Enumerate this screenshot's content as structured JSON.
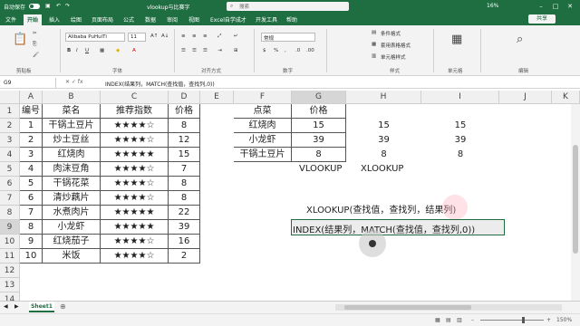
{
  "titlebar": {
    "autosave": "自动保存",
    "filename": "vlookup与比赛字",
    "search_placeholder": "搜索",
    "zoom_label": "16%"
  },
  "tabs": [
    "文件",
    "开始",
    "插入",
    "绘图",
    "页面布局",
    "公式",
    "数据",
    "审阅",
    "视图",
    "Excel自学成才",
    "开发工具",
    "帮助"
  ],
  "share_label": "共享",
  "ribbon": {
    "clipboard": "剪贴板",
    "font_name": "Alibaba PuHuiTi",
    "font_size": "11",
    "font_group": "字体",
    "align_group": "对齐方式",
    "number_group": "数字",
    "number_format": "常规",
    "styles": [
      "条件格式",
      "套用表格格式",
      "单元格样式"
    ],
    "styles_group": "样式",
    "cells_group": "单元格",
    "edit_group": "编辑"
  },
  "formula_bar": {
    "name_box": "G9",
    "formula": "INDEX(结果列，MATCH(查找值，查找列,0))"
  },
  "columns": [
    "A",
    "B",
    "C",
    "D",
    "E",
    "F",
    "G",
    "H",
    "I",
    "J",
    "K"
  ],
  "rows": [
    "1",
    "2",
    "3",
    "4",
    "5",
    "6",
    "7",
    "8",
    "9",
    "10",
    "11",
    "12",
    "13",
    "14",
    "15"
  ],
  "table1": {
    "headers": [
      "编号",
      "菜名",
      "推荐指数",
      "价格"
    ],
    "rows": [
      [
        "1",
        "干锅土豆片",
        "★★★★☆",
        "8"
      ],
      [
        "2",
        "炒土豆丝",
        "★★★★☆",
        "12"
      ],
      [
        "3",
        "红烧肉",
        "★★★★★",
        "15"
      ],
      [
        "4",
        "肉沫豆角",
        "★★★★☆",
        "7"
      ],
      [
        "5",
        "干锅花菜",
        "★★★★☆",
        "8"
      ],
      [
        "6",
        "清炒藕片",
        "★★★★☆",
        "8"
      ],
      [
        "7",
        "水煮肉片",
        "★★★★★",
        "22"
      ],
      [
        "8",
        "小龙虾",
        "★★★★★",
        "39"
      ],
      [
        "9",
        "红烧茄子",
        "★★★★☆",
        "16"
      ],
      [
        "10",
        "米饭",
        "★★★★☆",
        "2"
      ]
    ]
  },
  "table2": {
    "headers": [
      "点菜",
      "价格"
    ],
    "rows": [
      [
        "红烧肉",
        "15"
      ],
      [
        "小龙虾",
        "39"
      ],
      [
        "干锅土豆片",
        "8"
      ]
    ]
  },
  "col_h": [
    "15",
    "39",
    "8"
  ],
  "col_i": [
    "15",
    "39",
    "8"
  ],
  "labels": {
    "vlookup1": "VLOOKUP",
    "vlookup2": "XLOOKUP",
    "xlookup_formula": "XLOOKUP(查找值，查找列，结果列)",
    "index_formula": "INDEX(结果列，MATCH(查找值，查找列,0))"
  },
  "sheet_tab": "Sheet1",
  "status": {
    "zoom": "150%"
  }
}
